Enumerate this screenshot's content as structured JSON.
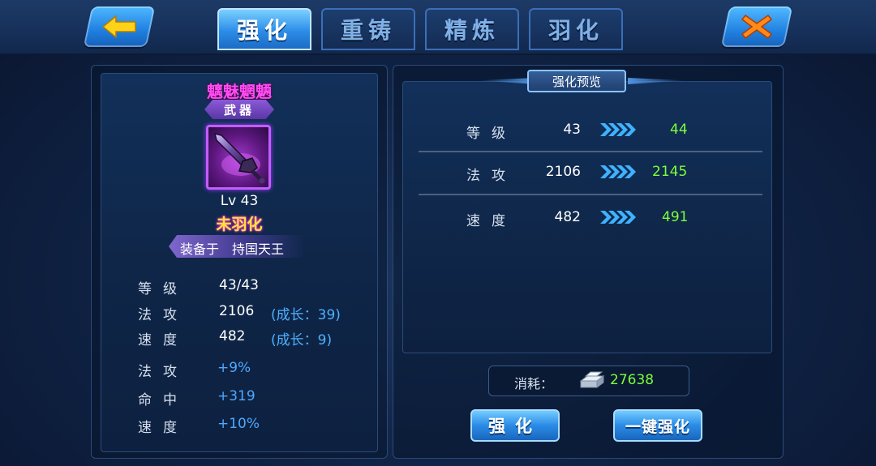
{
  "tabs": [
    {
      "label": "强化",
      "active": true
    },
    {
      "label": "重铸",
      "active": false
    },
    {
      "label": "精炼",
      "active": false
    },
    {
      "label": "羽化",
      "active": false
    }
  ],
  "item": {
    "name": "魑魅魍魉",
    "type": "武器",
    "level_text": "Lv 43",
    "feather_status": "未羽化",
    "equip_label": "装备于",
    "equipped_to": "持国天王"
  },
  "base_stats": [
    {
      "name": "等级",
      "value": "43/43",
      "growth": ""
    },
    {
      "name": "法攻",
      "value": "2106",
      "growth": "(成长：39)"
    },
    {
      "name": "速度",
      "value": "482",
      "growth": "(成长：9)"
    }
  ],
  "bonus_stats": [
    {
      "name": "法攻",
      "value": "+9%"
    },
    {
      "name": "命中",
      "value": "+319"
    },
    {
      "name": "速度",
      "value": "+10%"
    }
  ],
  "preview": {
    "title": "强化预览",
    "rows": [
      {
        "name": "等级",
        "current": "43",
        "next": "44"
      },
      {
        "name": "法攻",
        "current": "2106",
        "next": "2145"
      },
      {
        "name": "速度",
        "current": "482",
        "next": "491"
      }
    ]
  },
  "cost": {
    "label": "消耗：",
    "icon": "silver-ingot-icon",
    "value": "27638"
  },
  "buttons": {
    "enhance": "强化",
    "one_click": "一键强化"
  },
  "colors": {
    "item_name": "#ff4cf2",
    "increase": "#7cff3a",
    "growth": "#4fb1ff",
    "feather_status": "#ffe23a"
  }
}
